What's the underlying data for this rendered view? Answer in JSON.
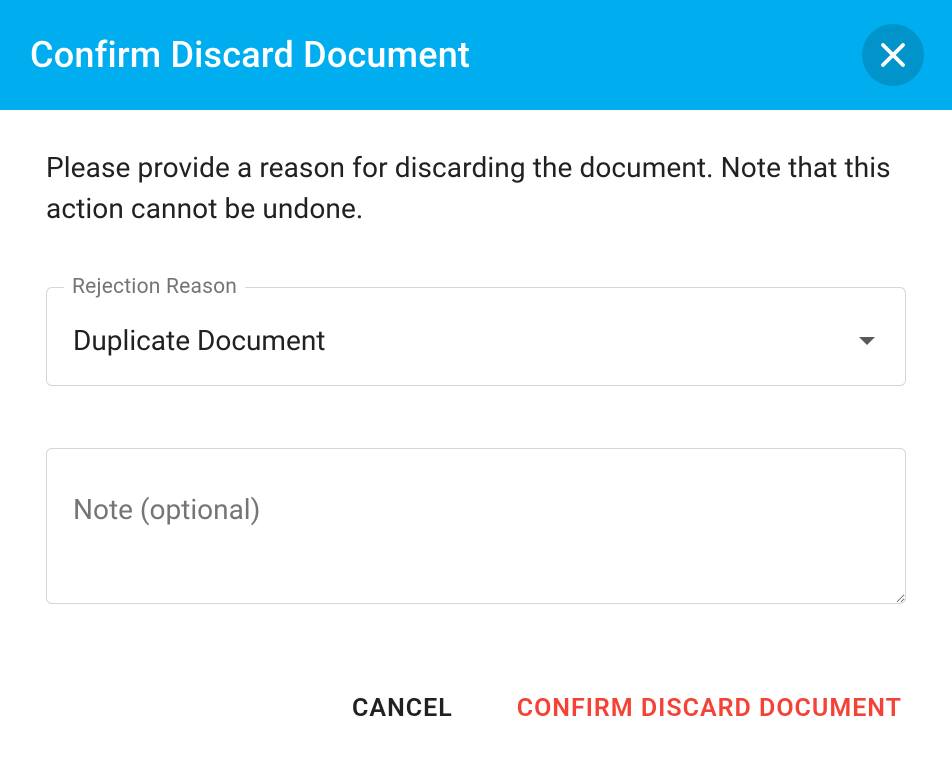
{
  "dialog": {
    "title": "Confirm Discard Document",
    "description": "Please provide a reason for discarding the document. Note that this action cannot be undone.",
    "rejection": {
      "label": "Rejection Reason",
      "selected": "Duplicate Document"
    },
    "note": {
      "placeholder": "Note (optional)",
      "value": ""
    },
    "actions": {
      "cancel": "CANCEL",
      "confirm": "CONFIRM DISCARD DOCUMENT"
    }
  }
}
